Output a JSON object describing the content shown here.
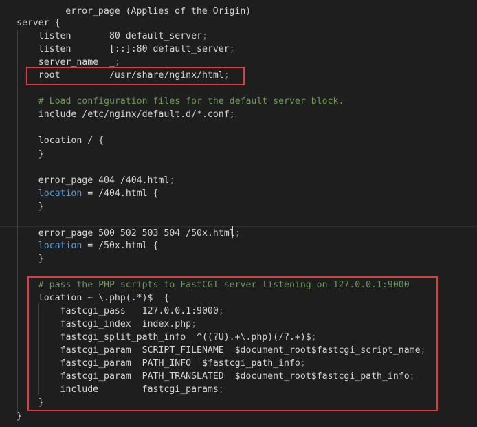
{
  "editor": {
    "top_clipped": "        error_page (Applies of the Origin) ",
    "lines": [
      {
        "indent": "",
        "parts": [
          {
            "t": "server {",
            "c": "text"
          }
        ]
      },
      {
        "indent": "    ",
        "parts": [
          {
            "t": "listen       80 default_server",
            "c": "text"
          },
          {
            "t": ";",
            "c": "dim"
          }
        ]
      },
      {
        "indent": "    ",
        "parts": [
          {
            "t": "listen       [::]:80 default_server",
            "c": "text"
          },
          {
            "t": ";",
            "c": "dim"
          }
        ]
      },
      {
        "indent": "    ",
        "parts": [
          {
            "t": "server_name  _",
            "c": "text"
          },
          {
            "t": ";",
            "c": "dim"
          }
        ]
      },
      {
        "indent": "    ",
        "parts": [
          {
            "t": "root         /usr/share/nginx/html",
            "c": "text"
          },
          {
            "t": ";",
            "c": "dim"
          }
        ]
      },
      {
        "indent": "",
        "parts": []
      },
      {
        "indent": "    ",
        "parts": [
          {
            "t": "# Load configuration files for the default server block.",
            "c": "comment"
          }
        ]
      },
      {
        "indent": "    ",
        "parts": [
          {
            "t": "include /etc/nginx/default.d/*.conf;",
            "c": "text"
          }
        ]
      },
      {
        "indent": "",
        "parts": []
      },
      {
        "indent": "    ",
        "parts": [
          {
            "t": "location / {",
            "c": "text"
          }
        ]
      },
      {
        "indent": "    ",
        "parts": [
          {
            "t": "}",
            "c": "text"
          }
        ]
      },
      {
        "indent": "",
        "parts": []
      },
      {
        "indent": "    ",
        "parts": [
          {
            "t": "error_page 404 /404.html",
            "c": "text"
          },
          {
            "t": ";",
            "c": "dim"
          }
        ]
      },
      {
        "indent": "    ",
        "parts": [
          {
            "t": "location",
            "c": "keyword"
          },
          {
            "t": " = /404.html {",
            "c": "text"
          }
        ]
      },
      {
        "indent": "    ",
        "parts": [
          {
            "t": "}",
            "c": "text"
          }
        ]
      },
      {
        "indent": "",
        "parts": []
      },
      {
        "indent": "    ",
        "parts": [
          {
            "t": "error_page 500 502 503 504 /50x.html",
            "c": "text"
          },
          {
            "t": ";",
            "c": "dim"
          }
        ]
      },
      {
        "indent": "    ",
        "parts": [
          {
            "t": "location",
            "c": "keyword"
          },
          {
            "t": " = /50x.html {",
            "c": "text"
          }
        ]
      },
      {
        "indent": "    ",
        "parts": [
          {
            "t": "}",
            "c": "text"
          }
        ]
      },
      {
        "indent": "",
        "parts": []
      },
      {
        "indent": "    ",
        "parts": [
          {
            "t": "# pass the PHP scripts to FastCGI server listening on 127.0.0.1:9000",
            "c": "comment"
          }
        ]
      },
      {
        "indent": "    ",
        "parts": [
          {
            "t": "location ~ \\.php(.*)$  {",
            "c": "text"
          }
        ]
      },
      {
        "indent": "        ",
        "parts": [
          {
            "t": "fastcgi_pass   127.0.0.1:9000",
            "c": "text"
          },
          {
            "t": ";",
            "c": "dim"
          }
        ]
      },
      {
        "indent": "        ",
        "parts": [
          {
            "t": "fastcgi_index  index.php",
            "c": "text"
          },
          {
            "t": ";",
            "c": "dim"
          }
        ]
      },
      {
        "indent": "        ",
        "parts": [
          {
            "t": "fastcgi_split_path_info  ^((?U).+\\.php)(/?.+)$",
            "c": "text"
          },
          {
            "t": ";",
            "c": "dim"
          }
        ]
      },
      {
        "indent": "        ",
        "parts": [
          {
            "t": "fastcgi_param  SCRIPT_FILENAME  $document_root$fastcgi_script_name",
            "c": "text"
          },
          {
            "t": ";",
            "c": "dim"
          }
        ]
      },
      {
        "indent": "        ",
        "parts": [
          {
            "t": "fastcgi_param  PATH_INFO  $fastcgi_path_info",
            "c": "text"
          },
          {
            "t": ";",
            "c": "dim"
          }
        ]
      },
      {
        "indent": "        ",
        "parts": [
          {
            "t": "fastcgi_param  PATH_TRANSLATED  $document_root$fastcgi_path_info",
            "c": "text"
          },
          {
            "t": ";",
            "c": "dim"
          }
        ]
      },
      {
        "indent": "        ",
        "parts": [
          {
            "t": "include        fastcgi_params",
            "c": "text"
          },
          {
            "t": ";",
            "c": "dim"
          }
        ]
      },
      {
        "indent": "    ",
        "parts": [
          {
            "t": "}",
            "c": "text"
          }
        ]
      },
      {
        "indent": "",
        "parts": [
          {
            "t": "}",
            "c": "text"
          }
        ]
      }
    ]
  },
  "colors": {
    "background": "#1e1e1e",
    "text": "#d4d4d4",
    "comment": "#6a9955",
    "keyword": "#569cd6",
    "highlight_border": "#e03c3c"
  }
}
